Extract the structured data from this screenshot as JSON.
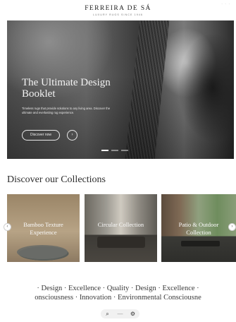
{
  "header": {
    "brand": "FERREIRA DE SÁ",
    "brand_sub": "LUXURY RUGS SINCE 1946",
    "top_dots": "·  ·  ·"
  },
  "hero": {
    "title": "The Ultimate Design Booklet",
    "description": "Timeless rugs that provide solutions to any living area. Discover the ultimate and everlasting rug experience.",
    "button_label": "Discover now",
    "arrow_icon": "arrow-right-icon",
    "slides_count": 3,
    "active_slide": 1
  },
  "collections": {
    "title": "Discover our Collections",
    "prev_icon": "chevron-left-icon",
    "next_icon": "chevron-right-icon",
    "items": [
      {
        "label": "Bamboo Texture Experience"
      },
      {
        "label": "Circular Collection"
      },
      {
        "label": "Patio & Outdoor Collection"
      }
    ]
  },
  "marquee": {
    "line1": "· Design · Excellence · Quality · Design · Excellence ·",
    "line2": "onsciousness · Innovation · Environmental Consciousne"
  },
  "toolbar": {
    "search_icon": "search-icon",
    "minus_icon": "minus-icon",
    "settings_icon": "gear-icon"
  },
  "colors": {
    "background": "#ffffff",
    "text": "#2b2b2b",
    "hero_text": "#f3f3f3"
  }
}
